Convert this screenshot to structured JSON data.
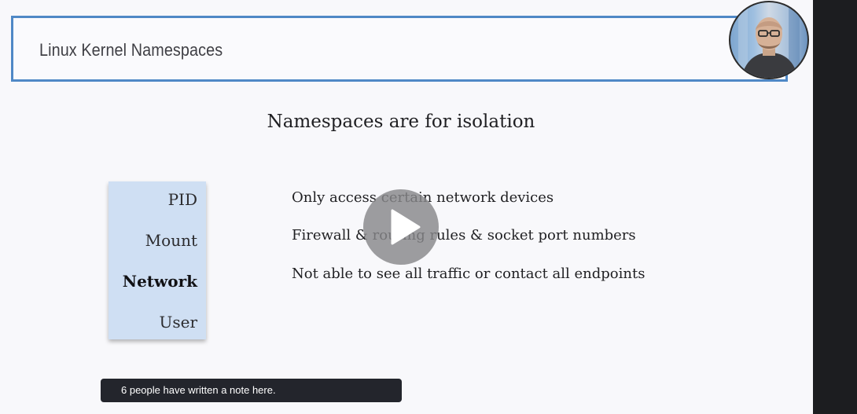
{
  "slide": {
    "title": "Linux Kernel Namespaces",
    "subtitle": "Namespaces are for isolation",
    "namespaces": [
      {
        "label": "PID",
        "active": false
      },
      {
        "label": "Mount",
        "active": false
      },
      {
        "label": "Network",
        "active": true
      },
      {
        "label": "User",
        "active": false
      }
    ],
    "bullets": [
      "Only access certain network devices",
      "Firewall & routing rules &  socket port numbers",
      "Not able to see all traffic or contact all endpoints"
    ]
  },
  "player": {
    "play_icon": "play-icon",
    "presenter_avatar": "presenter-webcam-avatar"
  },
  "notes": {
    "banner_text": "6 people have written a note here."
  },
  "colors": {
    "title_border": "#4f88c6",
    "namespace_panel": "#cfdff3",
    "banner_background": "#23252c",
    "sidebar": "#1c1d20"
  }
}
